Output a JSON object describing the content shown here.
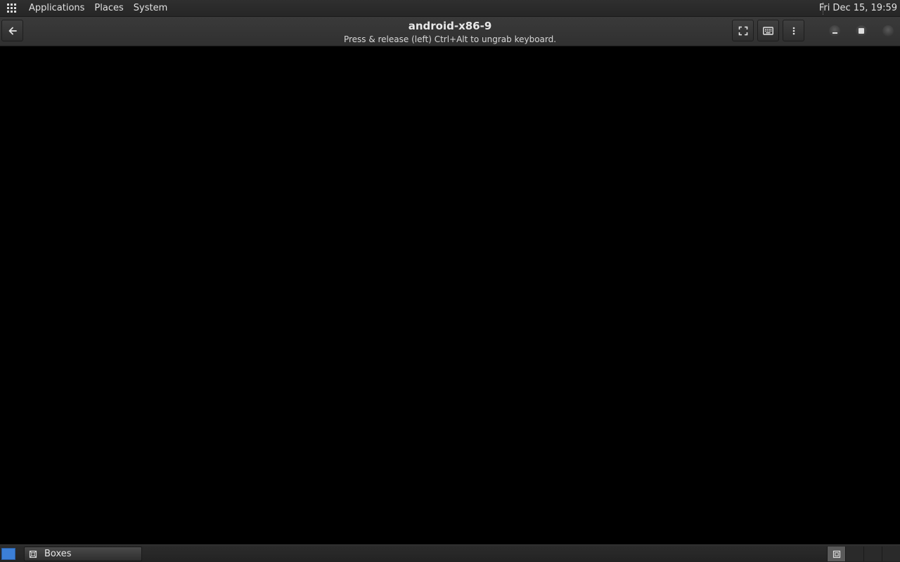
{
  "top_panel": {
    "menus": [
      "Applications",
      "Places",
      "System"
    ],
    "clock": "Fri Dec 15, 19:59"
  },
  "header": {
    "title": "android-x86-9",
    "subtitle": "Press & release (left) Ctrl+Alt to ungrab keyboard.",
    "icons": {
      "back": "back-arrow-icon",
      "fullscreen": "fullscreen-icon",
      "keyboard": "keyboard-icon",
      "menu": "vertical-dots-icon",
      "minimize": "minimize-icon",
      "maximize": "maximize-icon",
      "close": "close-icon"
    }
  },
  "taskbar": {
    "items": [
      {
        "label": "Boxes",
        "icon": "boxes-app-icon"
      }
    ]
  },
  "colors": {
    "show_desktop": "#3c7fd6",
    "vm_display": "#000000"
  }
}
